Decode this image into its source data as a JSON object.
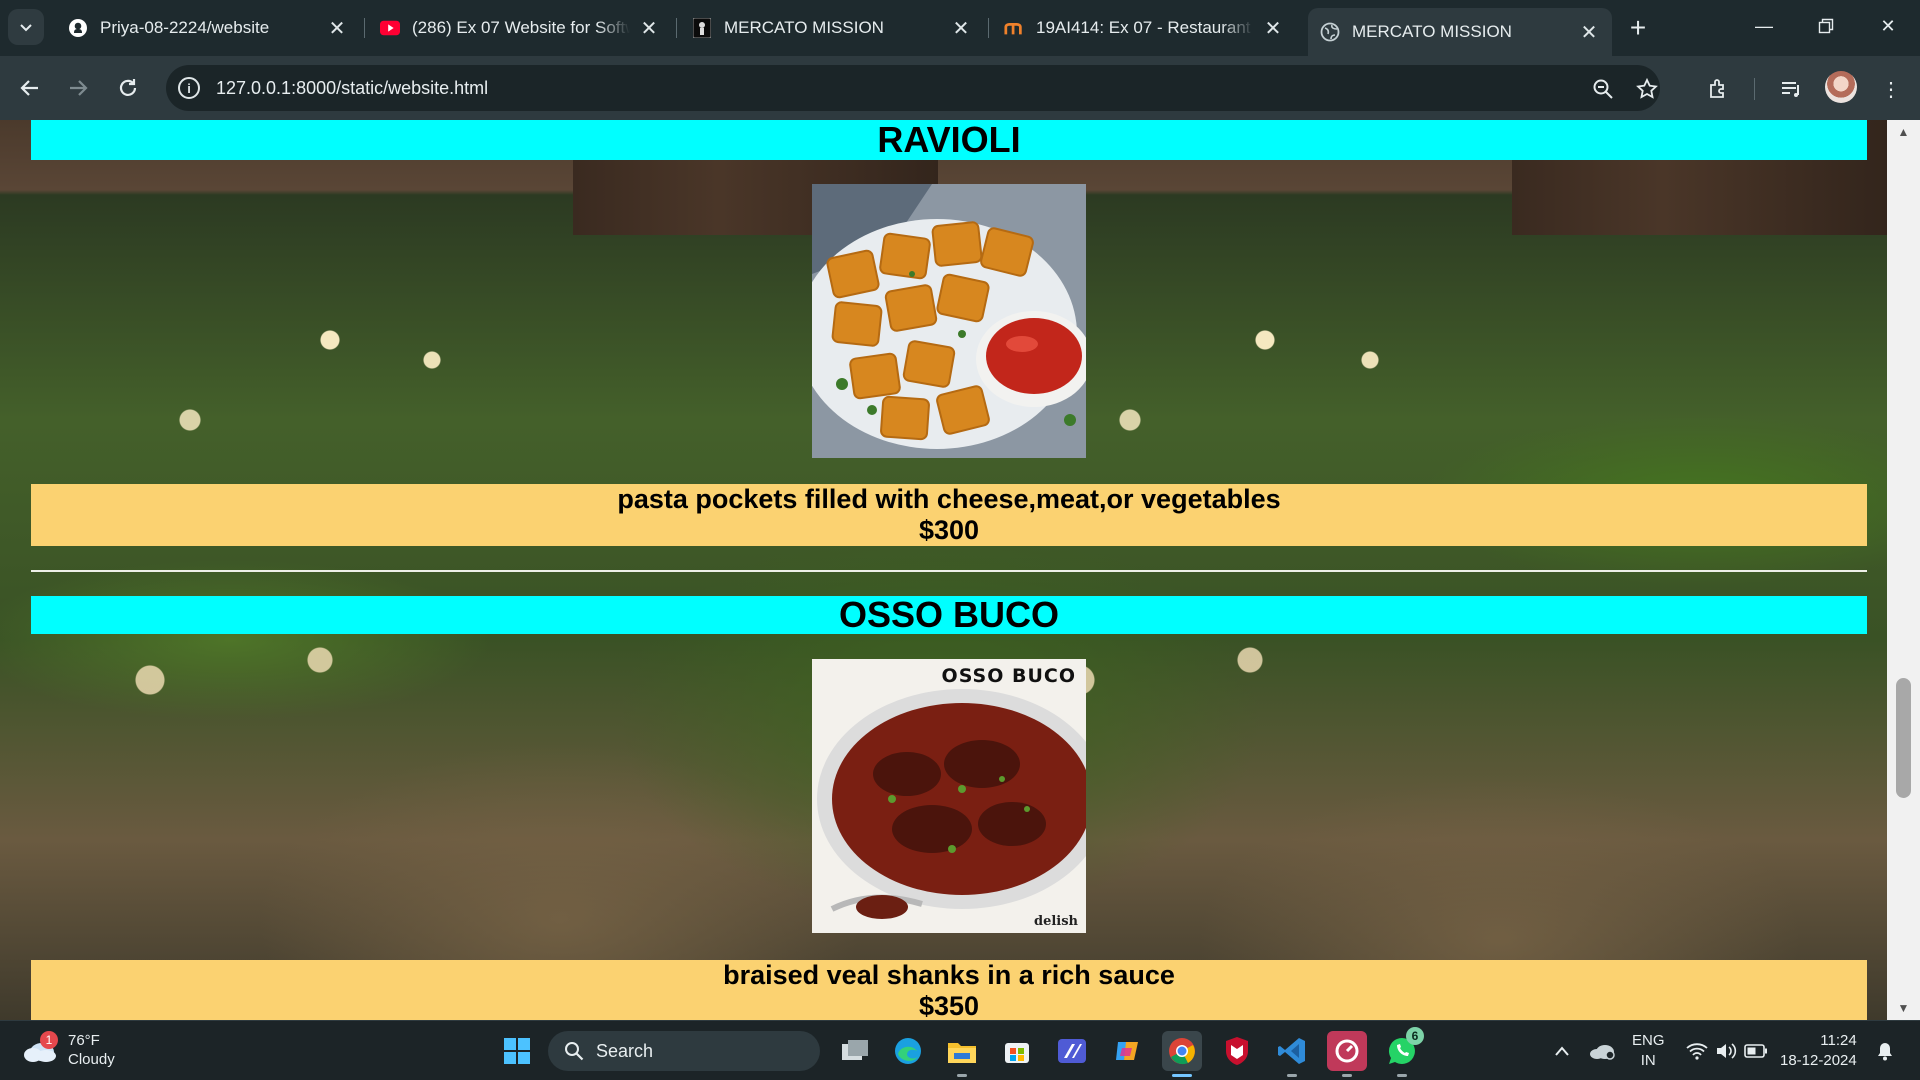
{
  "browser": {
    "tabs": [
      {
        "title": "Priya-08-2224/website",
        "icon": "github-icon"
      },
      {
        "title": "(286) Ex 07 Website for Software",
        "icon": "youtube-icon"
      },
      {
        "title": "MERCATO MISSION",
        "icon": "page-icon"
      },
      {
        "title": "19AI414: Ex 07 - Restaurant Website",
        "icon": "moodle-icon"
      },
      {
        "title": "MERCATO MISSION",
        "icon": "globe-icon",
        "active": true
      }
    ],
    "url": "127.0.0.1:8000/static/website.html"
  },
  "page": {
    "items": [
      {
        "name": "RAVIOLI",
        "description": "pasta pockets filled with cheese,meat,or vegetables",
        "price": "$300"
      },
      {
        "name": "OSSO BUCO",
        "image_caption": "OSSO BUCO",
        "image_watermark": "delish",
        "description": "braised veal shanks in a rich sauce",
        "price": "$350"
      }
    ]
  },
  "taskbar": {
    "weather": {
      "temp": "76°F",
      "condition": "Cloudy",
      "badge": "1"
    },
    "search_label": "Search",
    "whatsapp_badge": "6",
    "lang_line1": "ENG",
    "lang_line2": "IN",
    "time": "11:24",
    "date": "18-12-2024"
  },
  "colors": {
    "title_band": "#00ffff",
    "desc_band": "#fbd271",
    "browser_frame": "#1e2a2e",
    "toolbar": "#2e3a3f"
  }
}
